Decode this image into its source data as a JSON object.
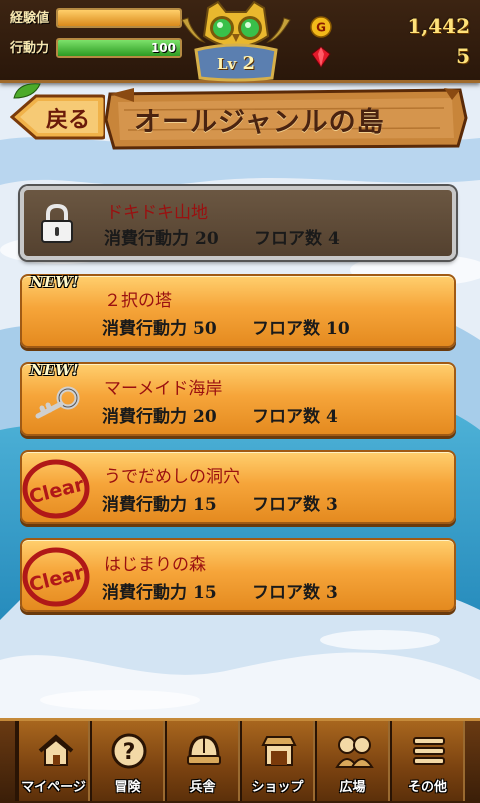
{
  "status": {
    "exp_label": "経験値",
    "exp_fraction": 1.0,
    "action_label": "行動力",
    "action_value": "100",
    "action_fraction": 1.0,
    "level_prefix": "Lv",
    "level": "2",
    "gold_icon_letter": "G",
    "gold": "1,442",
    "gems": "5"
  },
  "header": {
    "back_label": "戻る",
    "title": "オールジャンルの島"
  },
  "stage_labels": {
    "cost": "消費行動力",
    "floors": "フロア数"
  },
  "stages": [
    {
      "name": "ドキドキ山地",
      "cost": "20",
      "floors": "4",
      "state": "locked"
    },
    {
      "name": "２択の塔",
      "cost": "50",
      "floors": "10",
      "state": "new",
      "badge": "NEW!"
    },
    {
      "name": "マーメイド海岸",
      "cost": "20",
      "floors": "4",
      "state": "new-key",
      "badge": "NEW!"
    },
    {
      "name": "うでだめしの洞穴",
      "cost": "15",
      "floors": "3",
      "state": "clear",
      "badge": "Clear"
    },
    {
      "name": "はじまりの森",
      "cost": "15",
      "floors": "3",
      "state": "clear",
      "badge": "Clear"
    }
  ],
  "nav": [
    {
      "label": "マイページ",
      "icon": "house-icon"
    },
    {
      "label": "冒険",
      "icon": "question-icon"
    },
    {
      "label": "兵舎",
      "icon": "helmet-icon"
    },
    {
      "label": "ショップ",
      "icon": "shop-icon"
    },
    {
      "label": "広場",
      "icon": "people-icon"
    },
    {
      "label": "その他",
      "icon": "menu-icon"
    }
  ],
  "colors": {
    "accent_orange": "#f6a53a",
    "stage_name_red": "#9a1010",
    "nav_wood": "#7a4210"
  }
}
